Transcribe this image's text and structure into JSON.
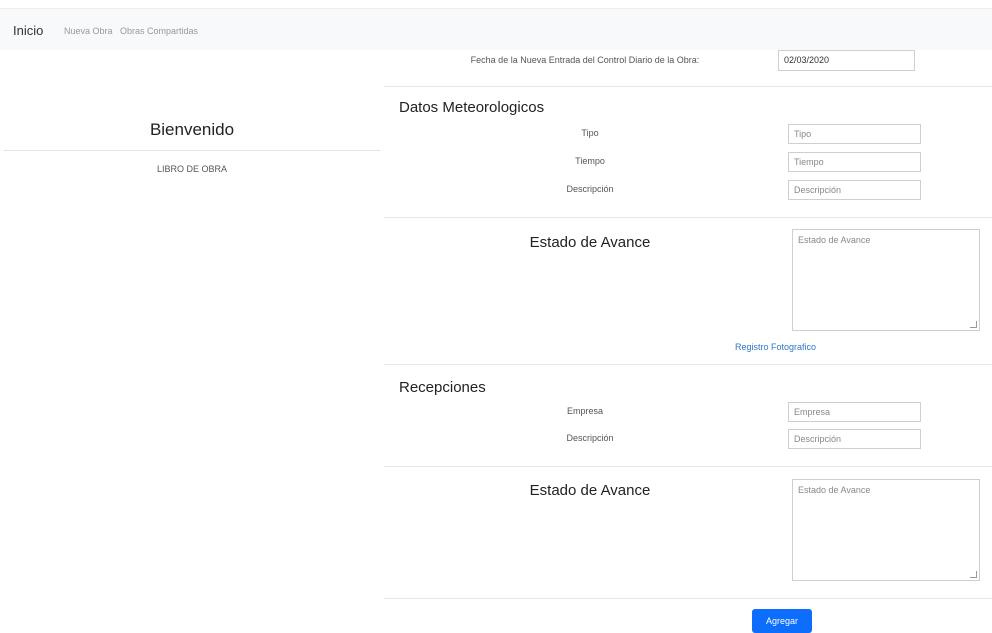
{
  "nav": {
    "brand": "Inicio",
    "links": [
      "Nueva Obra",
      "Obras Compartidas"
    ]
  },
  "sidebar": {
    "title": "Bienvenido",
    "subtitle": "LIBRO DE OBRA"
  },
  "form": {
    "date_label": "Fecha de la Nueva Entrada del Control Diario de la Obra:",
    "date_value": "02/03/2020",
    "weather": {
      "title": "Datos Meteorologicos",
      "tipo_label": "Tipo",
      "tipo_placeholder": "Tipo",
      "tiempo_label": "Tiempo",
      "tiempo_placeholder": "Tiempo",
      "descripcion_label": "Descripción",
      "descripcion_placeholder": "Descripción"
    },
    "avance1": {
      "title": "Estado de Avance",
      "placeholder": "Estado de Avance",
      "photo_link": "Registro Fotografico"
    },
    "recepciones": {
      "title": "Recepciones",
      "empresa_label": "Empresa",
      "empresa_placeholder": "Empresa",
      "descripcion_label": "Descripción",
      "descripcion_placeholder": "Descripción"
    },
    "avance2": {
      "title": "Estado de Avance",
      "placeholder": "Estado de Avance"
    },
    "submit_label": "Agregar"
  },
  "colors": {
    "primary": "#0d6efd",
    "link": "#2e78c8",
    "navbar_bg": "#f8f9fa"
  }
}
